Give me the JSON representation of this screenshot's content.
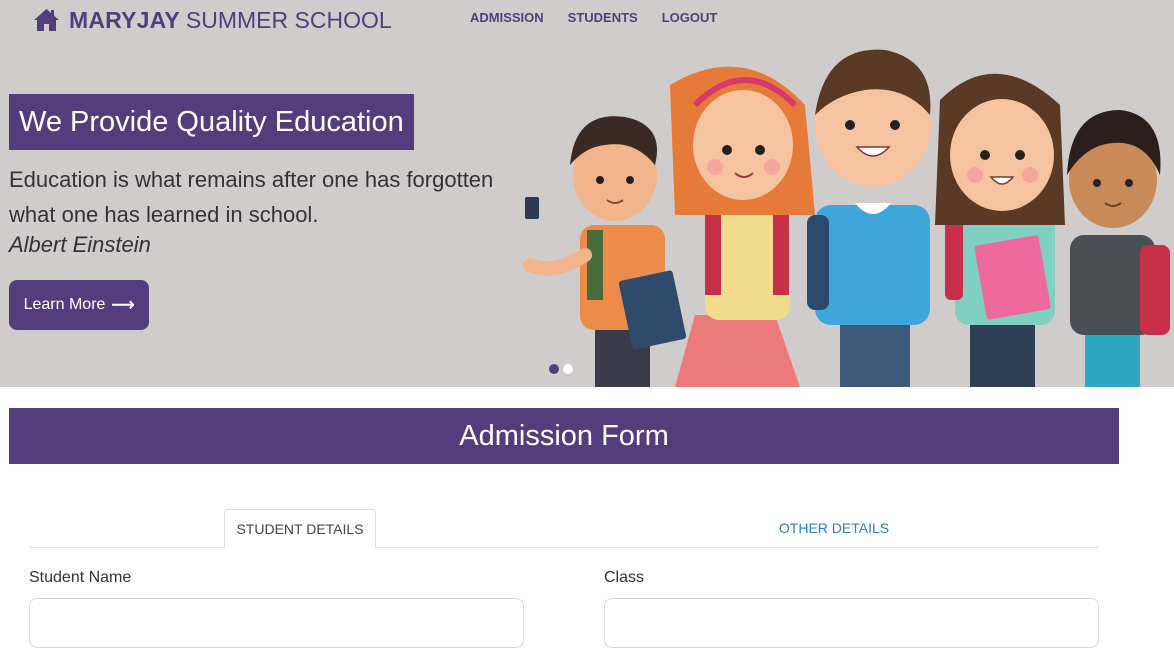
{
  "brand": {
    "bold": "MARYJAY",
    "light": "SUMMER SCHOOL",
    "icon": "home-icon"
  },
  "nav": {
    "admission": "ADMISSION",
    "students": "STUDENTS",
    "logout": "LOGOUT"
  },
  "hero": {
    "title": "We Provide Quality Education",
    "quote": "Education is what remains after one has forgotten what one has learned in school.",
    "author": "Albert Einstein",
    "button_label": "Learn More",
    "button_icon": "long-arrow-right-icon",
    "slide_count": 2,
    "active_slide": 1
  },
  "form": {
    "title": "Admission Form",
    "tabs": {
      "student": "STUDENT DETAILS",
      "other": "OTHER DETAILS"
    },
    "fields": {
      "student_name": "Student Name",
      "class": "Class"
    }
  },
  "colors": {
    "primary": "#533d7c",
    "hero_bg": "#d0cccc",
    "link": "#2a7bc9"
  }
}
